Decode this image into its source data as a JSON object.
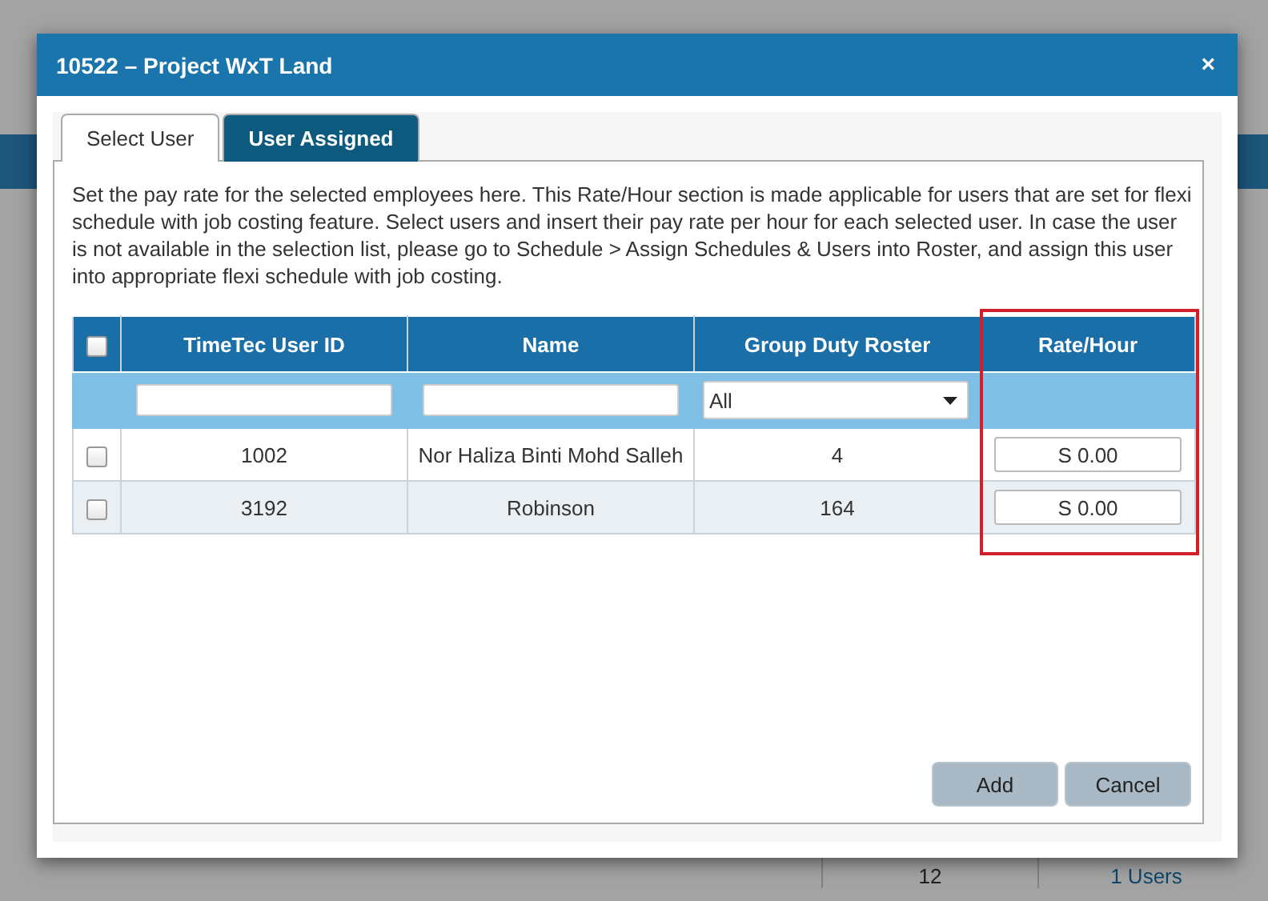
{
  "background": {
    "footer_cells": [
      "12",
      "1 Users"
    ]
  },
  "dialog": {
    "title": "10522 – Project WxT Land",
    "close": "×"
  },
  "tabs": [
    {
      "label": "Select User",
      "selected": true
    },
    {
      "label": "User Assigned",
      "selected": false
    }
  ],
  "description": "Set the pay rate for the selected employees here. This Rate/Hour section is made applicable for users that are set for flexi schedule with job costing feature. Select users and insert their pay rate per hour for each selected user. In case the user is not available in the selection list, please go to Schedule > Assign Schedules & Users into Roster, and assign this user into appropriate flexi schedule with job costing.",
  "table": {
    "select_all_checked": false,
    "columns": [
      "TimeTec User ID",
      "Name",
      "Group Duty Roster",
      "Rate/Hour"
    ],
    "filters": {
      "roster_select": "All"
    },
    "rows": [
      {
        "checked": false,
        "user_id": "1002",
        "name": "Nor Haliza Binti Mohd Salleh",
        "roster": "4",
        "rate": "S 0.00"
      },
      {
        "checked": false,
        "user_id": "3192",
        "name": "Robinson",
        "roster": "164",
        "rate": "S 0.00"
      }
    ]
  },
  "buttons": [
    "Add",
    "Cancel"
  ]
}
